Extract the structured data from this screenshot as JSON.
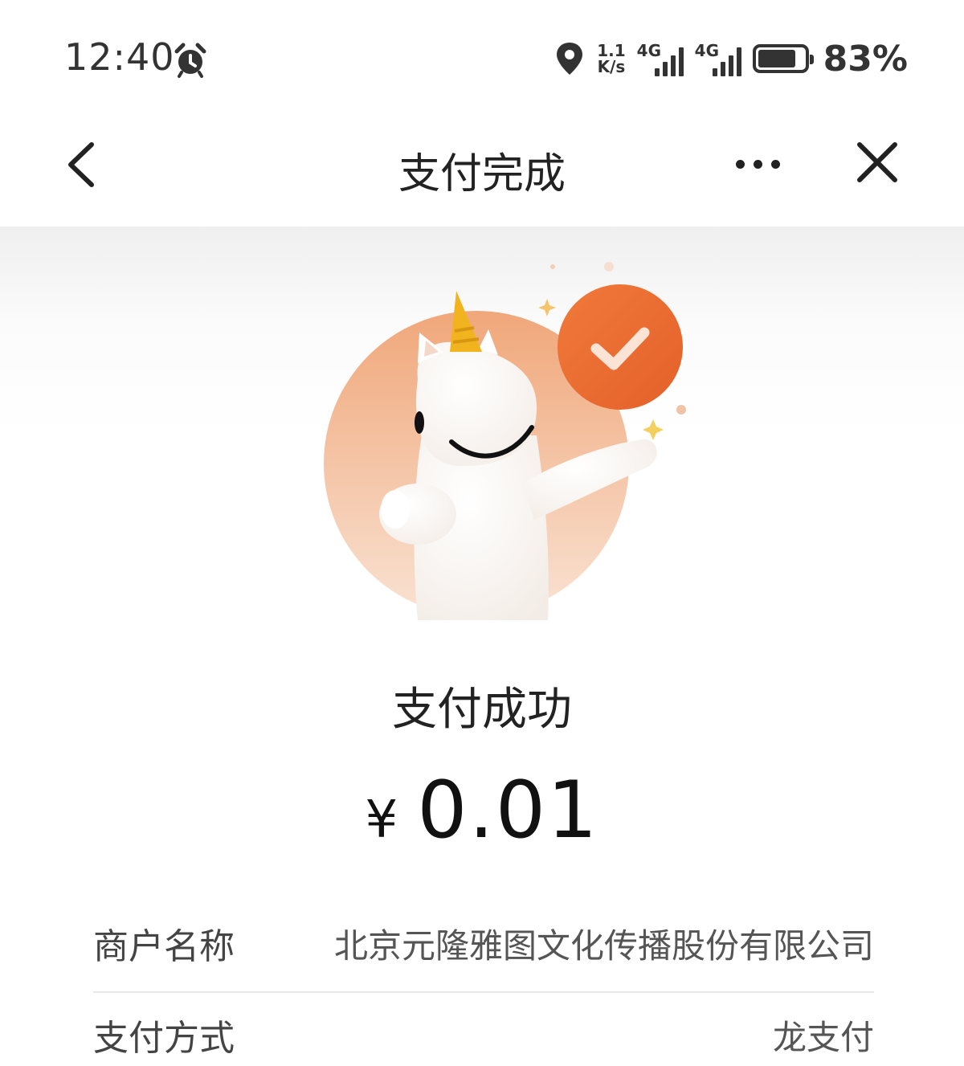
{
  "status_bar": {
    "time": "12:40",
    "speed_top": "1.1",
    "speed_bottom": "K/s",
    "net1_label": "4G",
    "net2_label": "4G",
    "battery_percent": "83%",
    "battery_level": 0.83,
    "icons": [
      "alarm-icon",
      "location-icon",
      "signal-icon",
      "battery-icon"
    ]
  },
  "nav": {
    "title": "支付完成",
    "icons": [
      "back-arrow-icon",
      "more-icon",
      "close-icon"
    ]
  },
  "result": {
    "title": "支付成功",
    "currency": "¥",
    "amount": "0.01",
    "accent_color": "#ec6a2c"
  },
  "details": [
    {
      "label": "商户名称",
      "value": "北京元隆雅图文化传播股份有限公司"
    },
    {
      "label": "支付方式",
      "value": "龙支付"
    }
  ]
}
